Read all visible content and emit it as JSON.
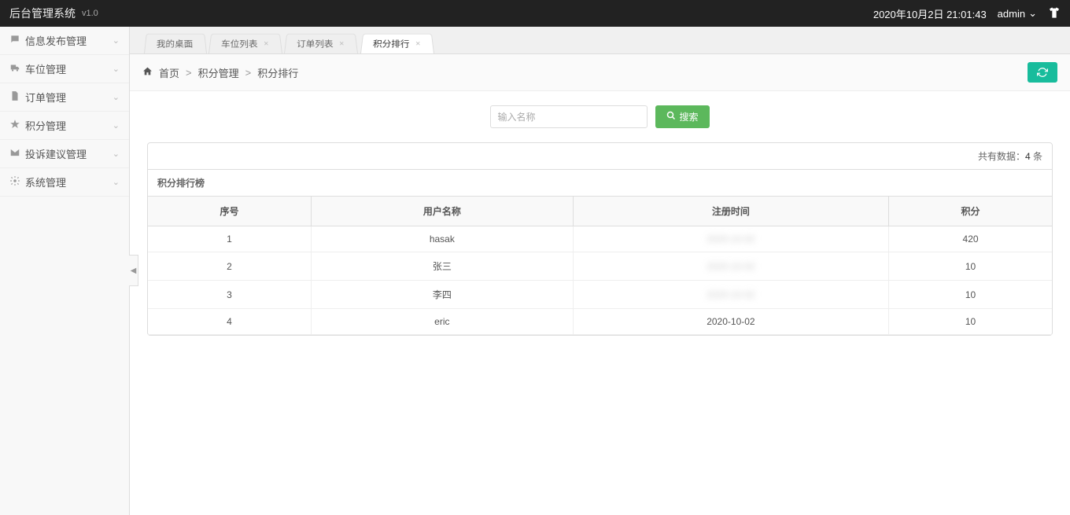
{
  "header": {
    "title": "后台管理系统",
    "version": "v1.0",
    "datetime": "2020年10月2日 21:01:43",
    "user": "admin"
  },
  "sidebar": {
    "items": [
      {
        "label": "信息发布管理",
        "icon": "chat"
      },
      {
        "label": "车位管理",
        "icon": "truck"
      },
      {
        "label": "订单管理",
        "icon": "file"
      },
      {
        "label": "积分管理",
        "icon": "star"
      },
      {
        "label": "投诉建议管理",
        "icon": "mail"
      },
      {
        "label": "系统管理",
        "icon": "gear"
      }
    ]
  },
  "tabs": [
    {
      "label": "我的桌面",
      "closable": false
    },
    {
      "label": "车位列表",
      "closable": true
    },
    {
      "label": "订单列表",
      "closable": true
    },
    {
      "label": "积分排行",
      "closable": true,
      "active": true
    }
  ],
  "breadcrumb": {
    "home": "首页",
    "parent": "积分管理",
    "current": "积分排行"
  },
  "search": {
    "placeholder": "输入名称",
    "button": "搜索"
  },
  "panel": {
    "total_label": "共有数据：",
    "total_count": "4",
    "total_suffix": " 条",
    "title": "积分排行榜"
  },
  "table": {
    "columns": [
      "序号",
      "用户名称",
      "注册时间",
      "积分"
    ],
    "rows": [
      {
        "index": "1",
        "name": "hasak",
        "date": "",
        "score": "420",
        "blurred": true
      },
      {
        "index": "2",
        "name": "张三",
        "date": "",
        "score": "10",
        "blurred": true
      },
      {
        "index": "3",
        "name": "李四",
        "date": "",
        "score": "10",
        "blurred": true
      },
      {
        "index": "4",
        "name": "eric",
        "date": "2020-10-02",
        "score": "10",
        "blurred": false
      }
    ]
  }
}
